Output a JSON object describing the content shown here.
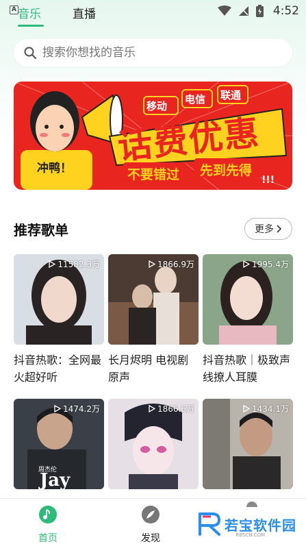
{
  "status": {
    "badge": "A",
    "time": "4:52"
  },
  "tabs": [
    {
      "label": "音乐",
      "active": true
    },
    {
      "label": "直播",
      "active": false
    }
  ],
  "search": {
    "placeholder": "搜索你想找的音乐"
  },
  "banner": {
    "headline": "话费优惠",
    "sub_left": "不要错过",
    "sub_right": "先到先得",
    "carriers": [
      "移动",
      "电信",
      "联通"
    ],
    "mascot_text": "冲鸭！",
    "exclaim": "!!!"
  },
  "section": {
    "title": "推荐歌单",
    "more_label": "更多"
  },
  "playlists": [
    {
      "title": "抖音热歌：全网最火超好听",
      "plays": "11582.3万"
    },
    {
      "title": "长月烬明 电视剧原声",
      "plays": "1866.9万"
    },
    {
      "title": "抖音热歌｜极致声线撩人耳膜",
      "plays": "1995.4万"
    },
    {
      "title": "",
      "plays": "1474.2万",
      "cover_text": "Jay",
      "cover_small": "周杰伦"
    },
    {
      "title": "",
      "plays": "1866.6万"
    },
    {
      "title": "",
      "plays": "1434.1万"
    }
  ],
  "bottom_nav": [
    {
      "label": "首页",
      "active": true
    },
    {
      "label": "发现",
      "active": false
    }
  ],
  "watermark": {
    "text": "若宝软件园",
    "sub": "RBSCN.COM"
  },
  "colors": {
    "accent": "#2dbb7a",
    "banner_red": "#e8261f",
    "banner_yellow": "#ffd21f"
  }
}
